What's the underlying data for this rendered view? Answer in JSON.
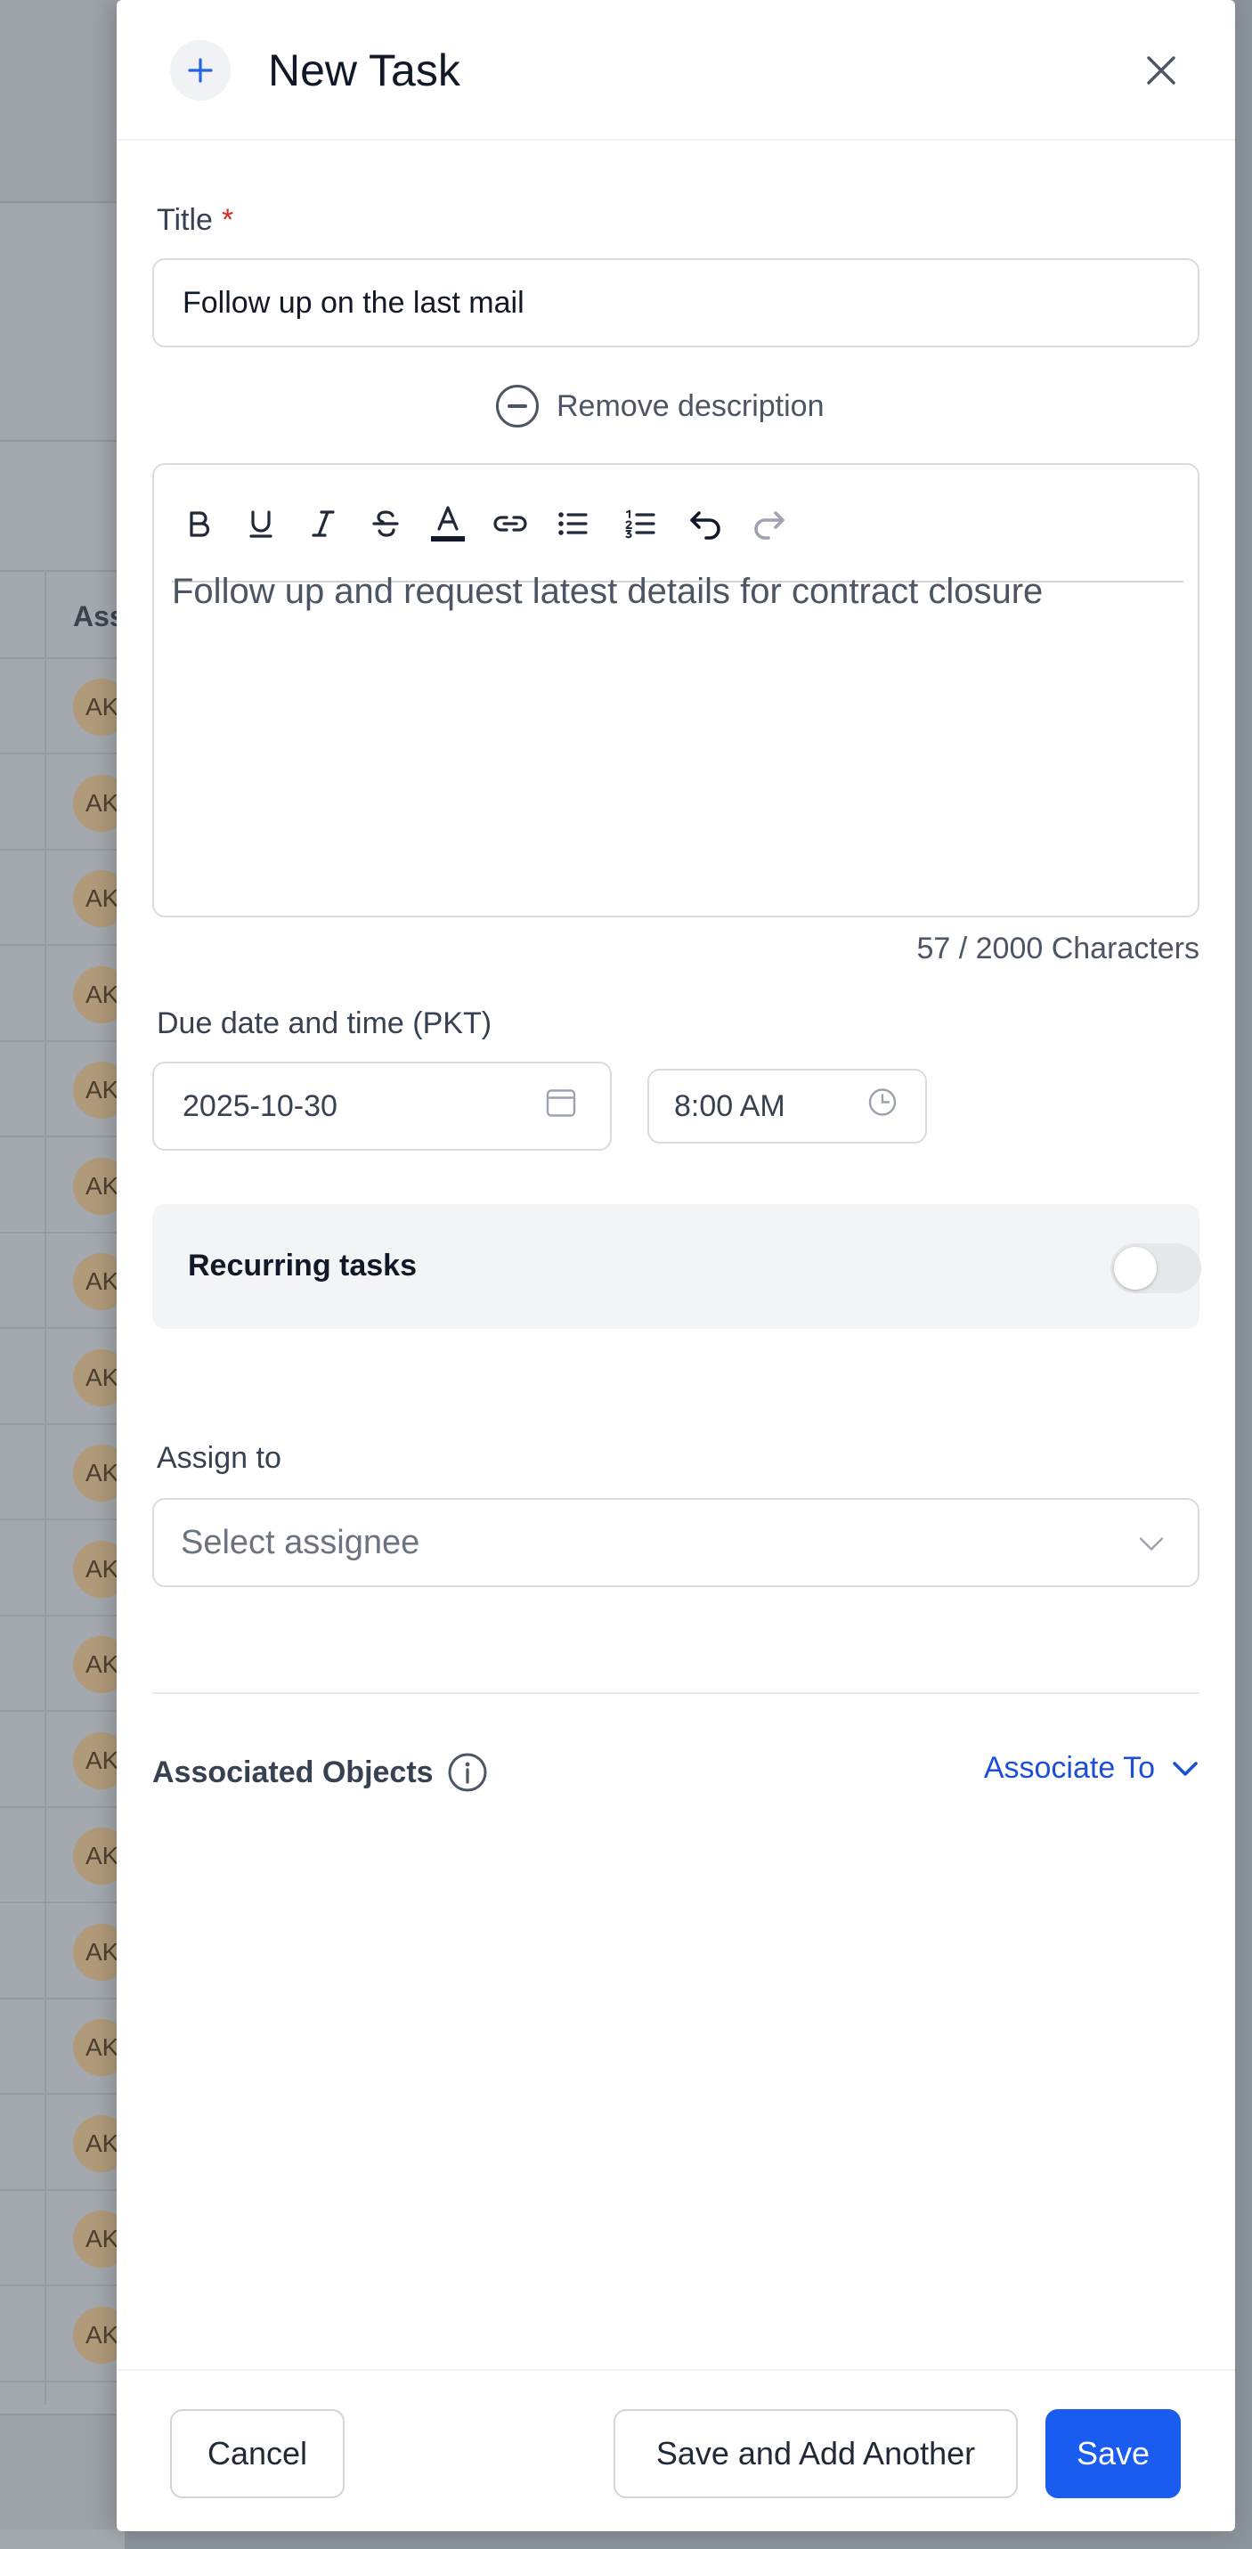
{
  "background": {
    "column_header": "Ass",
    "avatar_initials": "AK",
    "row_count": 18
  },
  "drawer": {
    "title": "New Task",
    "header_icon": "plus-icon",
    "close_icon": "close-icon"
  },
  "form": {
    "title_label": "Title",
    "title_required_mark": "*",
    "title_value": "Follow up on the last mail",
    "remove_description": "Remove description",
    "editor": {
      "toolbar": [
        "bold-icon",
        "underline-icon",
        "italic-icon",
        "strikethrough-icon",
        "text-color-icon",
        "link-icon",
        "bullet-list-icon",
        "numbered-list-icon",
        "undo-icon",
        "redo-icon"
      ],
      "content": "Follow up and request latest details for contract closure"
    },
    "char_count": "57 / 2000 Characters",
    "due_label": "Due date and time (PKT)",
    "due_date": "2025-10-30",
    "due_time": "8:00 AM",
    "recurring_label": "Recurring tasks",
    "recurring_enabled": false,
    "assign_label": "Assign to",
    "assign_placeholder": "Select assignee",
    "associated_label": "Associated Objects",
    "associate_link": "Associate To"
  },
  "footer": {
    "cancel": "Cancel",
    "save_and_add": "Save and Add Another",
    "save": "Save"
  },
  "colors": {
    "primary": "#1a5cf0",
    "link": "#1d4ed8",
    "required": "#dc2626",
    "overlay": "#8a929b"
  }
}
